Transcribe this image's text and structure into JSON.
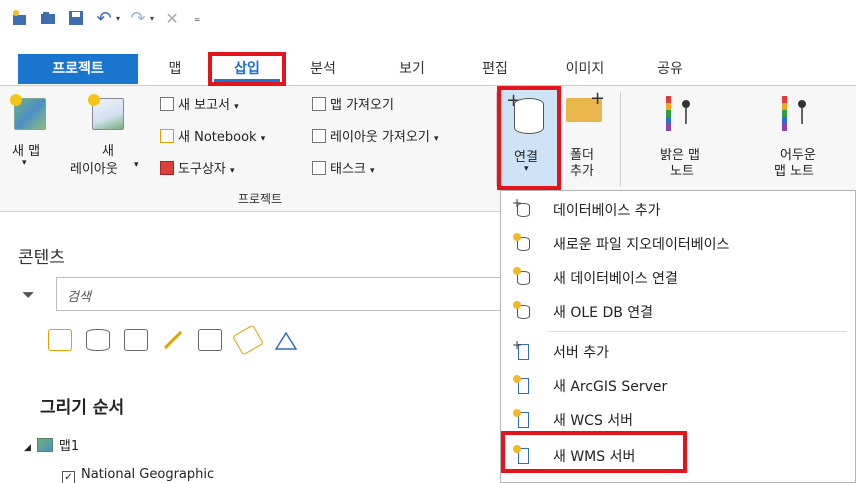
{
  "qat": {
    "icons": [
      "new-project-icon",
      "open-icon",
      "save-icon",
      "undo-icon",
      "redo-icon",
      "close-icon",
      "customize-icon"
    ]
  },
  "tabs": [
    {
      "label": "프로젝트"
    },
    {
      "label": "맵"
    },
    {
      "label": "삽입"
    },
    {
      "label": "분석"
    },
    {
      "label": "보기"
    },
    {
      "label": "편집"
    },
    {
      "label": "이미지"
    },
    {
      "label": "공유"
    }
  ],
  "ribbon": {
    "new_map": "새 맵",
    "new_layout_1": "새",
    "new_layout_2": "레이아웃",
    "new_report": "새 보고서",
    "new_notebook": "새 Notebook",
    "toolbox": "도구상자",
    "import_map": "맵 가져오기",
    "import_layout": "레이아웃 가져오기",
    "task": "태스크",
    "group_project": "프로젝트",
    "connect": "연결",
    "folder_1": "폴더",
    "folder_2": "추가",
    "bright_note_1": "밝은 맵",
    "bright_note_2": "노트",
    "dark_note_1": "어두운",
    "dark_note_2": "맵 노트",
    "note_colors": [
      "#e13b3b",
      "#f2a81d",
      "#2f9e44",
      "#2b6fd1",
      "#8e44ad"
    ]
  },
  "panel": {
    "title": "콘텐츠",
    "search_placeholder": "검색",
    "draw_order": "그리기 순서",
    "map_name": "맵1",
    "layer_name": "National Geographic"
  },
  "menu": {
    "items": [
      {
        "label": "데이터베이스 추가",
        "icon": "add-database-icon"
      },
      {
        "label": "새로운 파일 지오데이터베이스",
        "icon": "new-file-gdb-icon"
      },
      {
        "label": "새 데이터베이스 연결",
        "icon": "new-db-connection-icon"
      },
      {
        "label": "새 OLE DB 연결",
        "icon": "new-oledb-icon"
      },
      {
        "label": "서버 추가",
        "icon": "add-server-icon"
      },
      {
        "label": "새 ArcGIS Server",
        "icon": "arcgis-server-icon"
      },
      {
        "label": "새 WCS 서버",
        "icon": "wcs-server-icon"
      },
      {
        "label": "새 WMS 서버",
        "icon": "wms-server-icon"
      }
    ]
  },
  "colors": {
    "accent": "#1a75cf",
    "highlight_box": "#e3141c",
    "connect_hover": "#cfe3f7"
  }
}
